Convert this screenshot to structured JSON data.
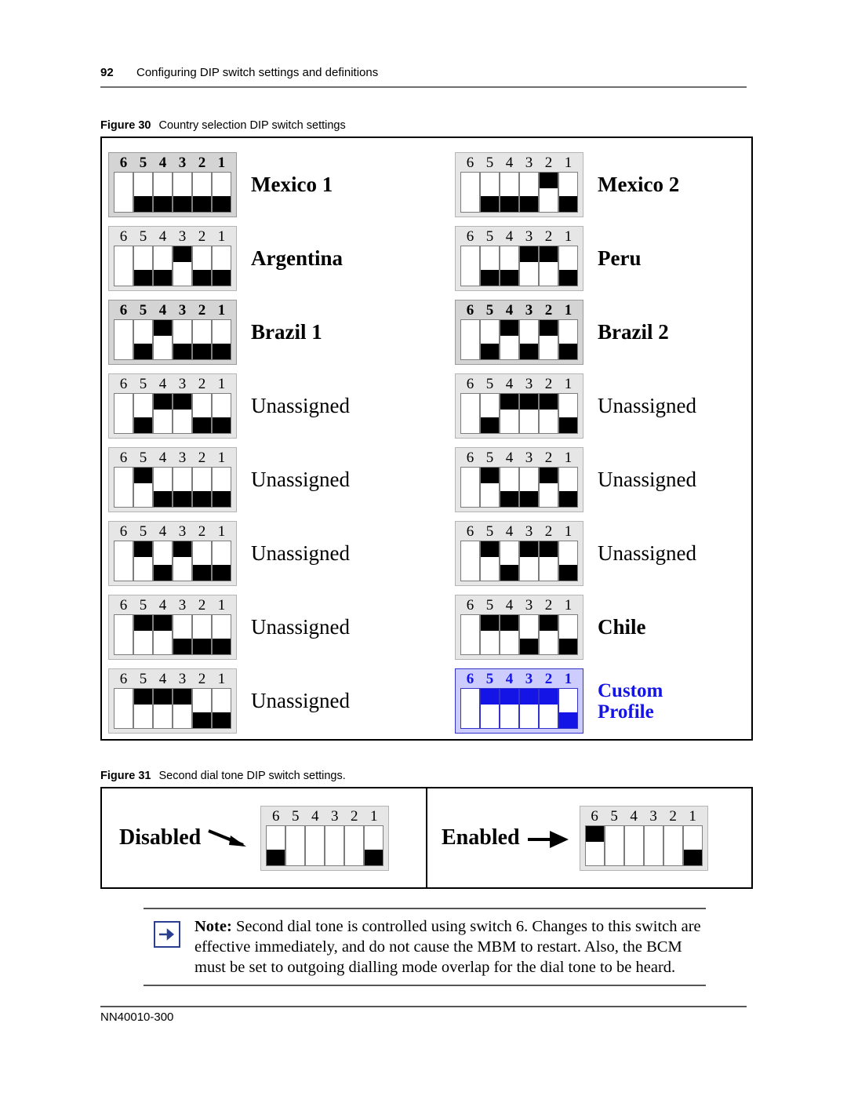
{
  "header": {
    "page_number": "92",
    "title": "Configuring DIP switch settings and definitions"
  },
  "figure30": {
    "label": "Figure 30",
    "text": "Country selection DIP switch settings",
    "switch_numbers": [
      "6",
      "5",
      "4",
      "3",
      "2",
      "1"
    ],
    "rows": [
      {
        "label": "Mexico 1",
        "style": "dark",
        "bold_label": true,
        "positions": [
          "none",
          "down",
          "down",
          "down",
          "down",
          "down"
        ]
      },
      {
        "label": "Mexico 2",
        "style": "light",
        "bold_label": true,
        "positions": [
          "none",
          "down",
          "down",
          "down",
          "up",
          "down"
        ]
      },
      {
        "label": "Argentina",
        "style": "light",
        "bold_label": true,
        "positions": [
          "none",
          "down",
          "down",
          "up",
          "down",
          "down"
        ]
      },
      {
        "label": "Peru",
        "style": "light",
        "bold_label": true,
        "positions": [
          "none",
          "down",
          "down",
          "up",
          "up",
          "down"
        ]
      },
      {
        "label": "Brazil 1",
        "style": "dark",
        "bold_label": true,
        "positions": [
          "none",
          "down",
          "up",
          "down",
          "down",
          "down"
        ]
      },
      {
        "label": "Brazil 2",
        "style": "dark",
        "bold_label": true,
        "positions": [
          "none",
          "down",
          "up",
          "down",
          "up",
          "down"
        ]
      },
      {
        "label": "Unassigned",
        "style": "light",
        "bold_label": false,
        "positions": [
          "none",
          "down",
          "up",
          "up",
          "down",
          "down"
        ]
      },
      {
        "label": "Unassigned",
        "style": "light",
        "bold_label": false,
        "positions": [
          "none",
          "down",
          "up",
          "up",
          "up",
          "down"
        ]
      },
      {
        "label": "Unassigned",
        "style": "light",
        "bold_label": false,
        "positions": [
          "none",
          "up",
          "down",
          "down",
          "down",
          "down"
        ]
      },
      {
        "label": "Unassigned",
        "style": "light",
        "bold_label": false,
        "positions": [
          "none",
          "up",
          "down",
          "down",
          "up",
          "down"
        ]
      },
      {
        "label": "Unassigned",
        "style": "light",
        "bold_label": false,
        "positions": [
          "none",
          "up",
          "down",
          "up",
          "down",
          "down"
        ]
      },
      {
        "label": "Unassigned",
        "style": "light",
        "bold_label": false,
        "positions": [
          "none",
          "up",
          "down",
          "up",
          "up",
          "down"
        ]
      },
      {
        "label": "Unassigned",
        "style": "light",
        "bold_label": false,
        "positions": [
          "none",
          "up",
          "up",
          "down",
          "down",
          "down"
        ]
      },
      {
        "label": "Chile",
        "style": "light",
        "bold_label": true,
        "positions": [
          "none",
          "up",
          "up",
          "down",
          "up",
          "down"
        ]
      },
      {
        "label": "Unassigned",
        "style": "light",
        "bold_label": false,
        "positions": [
          "none",
          "up",
          "up",
          "up",
          "down",
          "down"
        ]
      },
      {
        "label": "Custom Profile",
        "style": "custom",
        "bold_label": true,
        "positions": [
          "none",
          "up",
          "up",
          "up",
          "up",
          "down"
        ]
      }
    ]
  },
  "figure31": {
    "label": "Figure 31",
    "text": "Second dial tone DIP switch settings.",
    "switch_numbers": [
      "6",
      "5",
      "4",
      "3",
      "2",
      "1"
    ],
    "blocks": [
      {
        "label": "Disabled",
        "positions": [
          "down",
          "none",
          "none",
          "none",
          "none",
          "down"
        ]
      },
      {
        "label": "Enabled",
        "positions": [
          "up",
          "none",
          "none",
          "none",
          "none",
          "down"
        ]
      }
    ]
  },
  "note": {
    "prefix": "Note:",
    "text": " Second dial tone is controlled using switch 6. Changes to this switch are effective immediately, and do not cause the MBM to restart. Also, the BCM must be set to outgoing dialling mode overlap for the dial tone to be heard.",
    "icon": "right-arrow-icon",
    "icon_color": "#2a3f8f"
  },
  "footer": {
    "doc_number": "NN40010-300"
  },
  "colors": {
    "custom_accent": "#1414e6",
    "custom_background": "#ccccff",
    "block_dark": "#d4d4d4",
    "block_light": "#e6e6e6"
  }
}
